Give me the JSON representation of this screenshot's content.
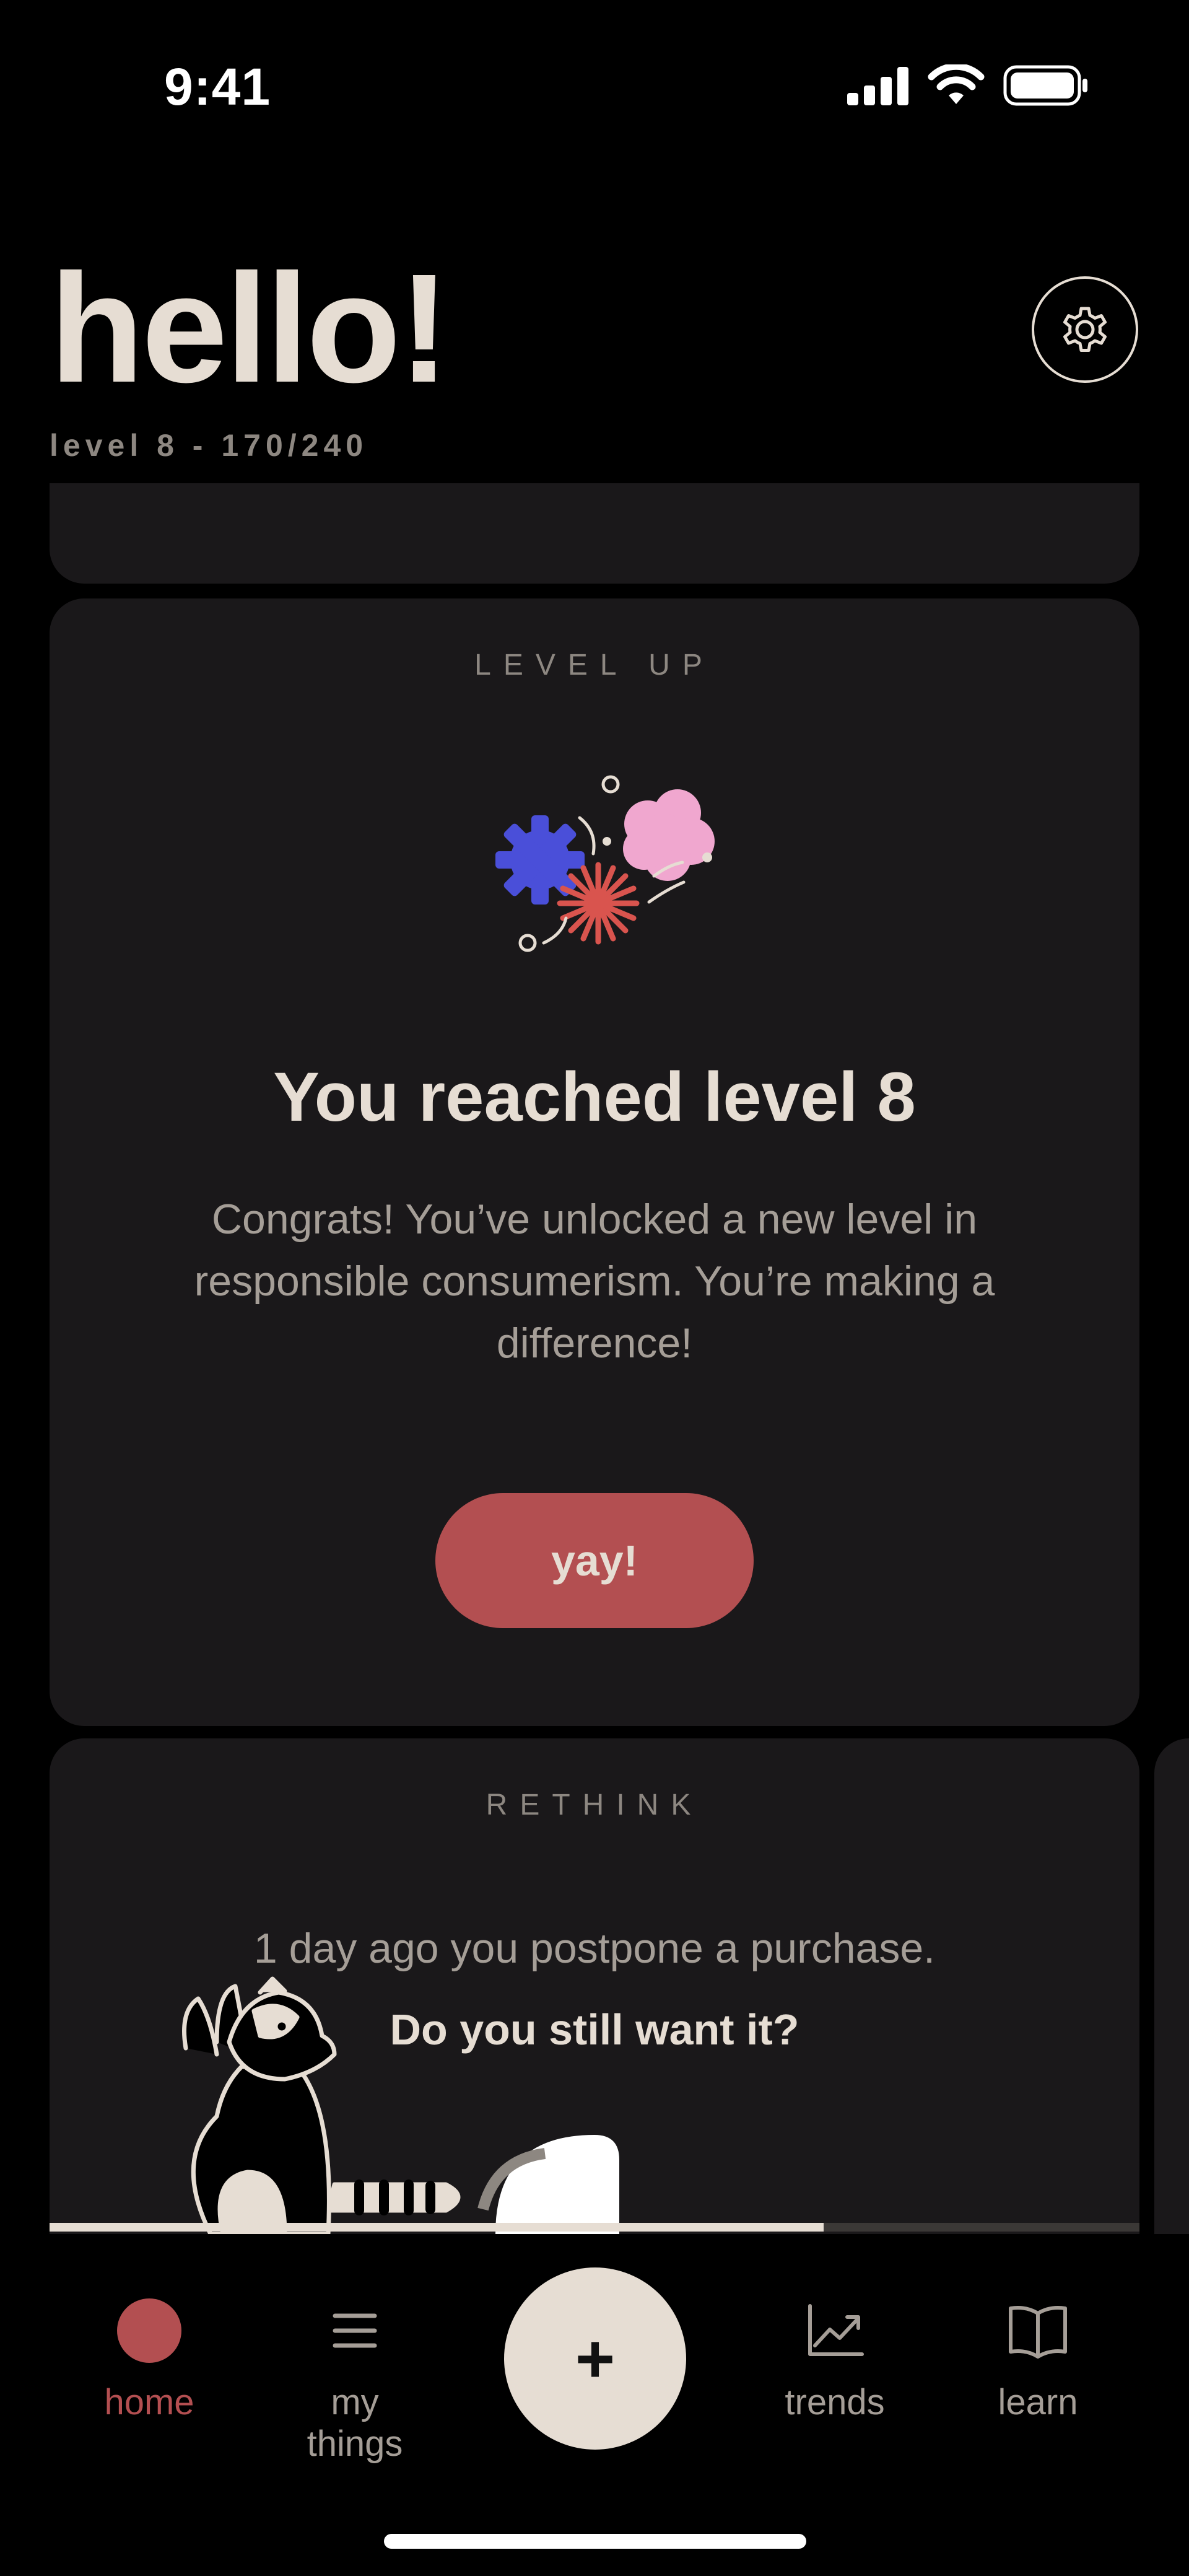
{
  "status_bar": {
    "time": "9:41"
  },
  "header": {
    "greeting": "hello!",
    "level_progress": "level 8 - 170/240"
  },
  "level_card": {
    "eyebrow": "LEVEL UP",
    "title": "You reached level 8",
    "body": "Congrats! You’ve unlocked a new level in responsible consumerism. You’re making a difference!",
    "button_label": "yay!"
  },
  "rethink_card": {
    "eyebrow": "RETHINK",
    "line1": "1 day ago you postpone a purchase.",
    "line2": "Do you still want it?",
    "progress_fraction": 0.71
  },
  "tab_bar": {
    "tabs": [
      {
        "label": "home",
        "icon": "home-dot-icon",
        "active": true
      },
      {
        "label": "my things",
        "icon": "list-icon",
        "active": false
      },
      {
        "label": "+",
        "icon": "plus-icon",
        "active": false
      },
      {
        "label": "trends",
        "icon": "trend-chart-icon",
        "active": false
      },
      {
        "label": "learn",
        "icon": "book-icon",
        "active": false
      }
    ]
  },
  "colors": {
    "background": "#000000",
    "card": "#1a181a",
    "accent_red": "#b34f51",
    "cream": "#e6ddd3",
    "muted": "#a59e97"
  }
}
